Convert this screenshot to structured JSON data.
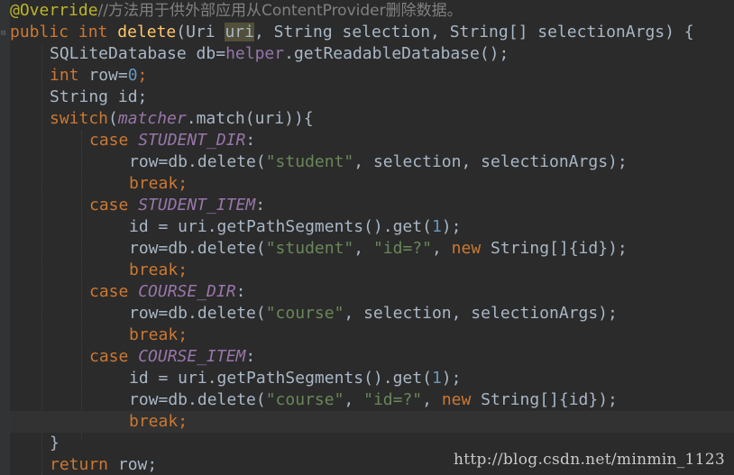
{
  "code": {
    "l1": {
      "annotation": "@Override",
      "comment": "//方法用于供外部应用从ContentProvider删除数据。"
    },
    "l2": {
      "kw_public": "public",
      "kw_int": "int",
      "name": "delete",
      "p1": "(Uri ",
      "uri": "uri",
      "p2": ", String selection, String[] selectionArgs) {"
    },
    "l3": {
      "a": "SQLiteDatabase db=",
      "field": "helper",
      "b": ".getReadableDatabase();"
    },
    "l4": {
      "kw": "int",
      "a": " row=",
      "num": "0",
      "b": ";"
    },
    "l5": {
      "a": "String id;"
    },
    "l6": {
      "kw": "switch",
      "a": "(",
      "field": "matcher",
      "b": ".match(uri)){"
    },
    "l7": {
      "kw": "case ",
      "const": "STUDENT_DIR",
      "b": ":"
    },
    "l8": {
      "a": "row=db.delete(",
      "str": "\"student\"",
      "b": ", selection, selectionArgs);"
    },
    "l9": {
      "kw": "break",
      "b": ";"
    },
    "l10": {
      "kw": "case ",
      "const": "STUDENT_ITEM",
      "b": ":"
    },
    "l11": {
      "a": "id = uri.getPathSegments().get(",
      "num": "1",
      "b": ");"
    },
    "l12": {
      "a": "row=db.delete(",
      "str1": "\"student\"",
      "c": ", ",
      "str2": "\"id=?\"",
      "d": ", ",
      "kw": "new",
      "e": " String[]{id});"
    },
    "l13": {
      "kw": "break",
      "b": ";"
    },
    "l14": {
      "kw": "case ",
      "const": "COURSE_DIR",
      "b": ":"
    },
    "l15": {
      "a": "row=db.delete(",
      "str": "\"course\"",
      "b": ", selection, selectionArgs);"
    },
    "l16": {
      "kw": "break",
      "b": ";"
    },
    "l17": {
      "kw": "case ",
      "const": "COURSE_ITEM",
      "b": ":"
    },
    "l18": {
      "a": "id = uri.getPathSegments().get(",
      "num": "1",
      "b": ");"
    },
    "l19": {
      "a": "row=db.delete(",
      "str1": "\"course\"",
      "c": ", ",
      "str2": "\"id=?\"",
      "d": ", ",
      "kw": "new",
      "e": " String[]{id});"
    },
    "l20": {
      "kw": "break",
      "b": ";"
    },
    "l21": {
      "a": "}"
    },
    "l22": {
      "kw": "return",
      "a": " row;"
    }
  },
  "watermark": "http://blog.csdn.net/minmin_1123"
}
